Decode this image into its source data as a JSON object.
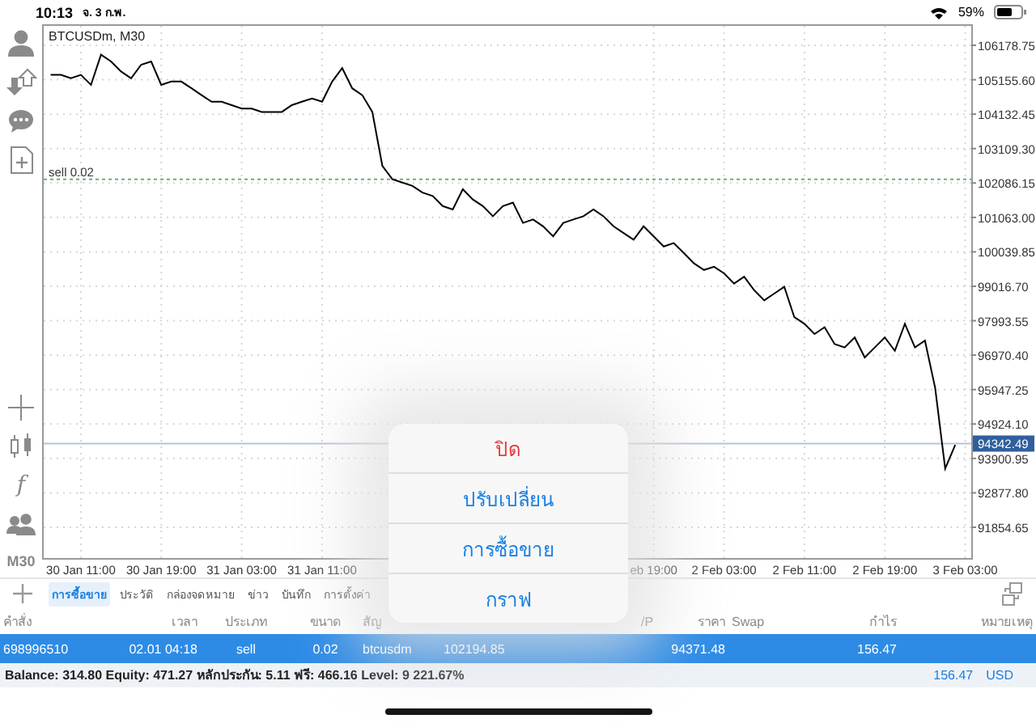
{
  "status_bar": {
    "time": "10:13",
    "date": "จ. 3 ก.พ.",
    "battery": "59%"
  },
  "toolbar": {
    "top": [
      {
        "kind": "person"
      },
      {
        "kind": "arrows"
      },
      {
        "kind": "chat"
      },
      {
        "kind": "document"
      }
    ],
    "bottom": [
      {
        "kind": "crosshair"
      },
      {
        "kind": "candles"
      },
      {
        "kind": "text",
        "label": "f"
      },
      {
        "kind": "people"
      },
      {
        "kind": "text",
        "label": "M30"
      }
    ]
  },
  "chart": {
    "title": "BTCUSDm, M30",
    "chart_data": {
      "type": "line",
      "grid": true,
      "categories": [
        null,
        null,
        null,
        "30 Jan 11:00",
        null,
        null,
        null,
        null,
        null,
        null,
        null,
        "30 Jan 19:00",
        null,
        null,
        null,
        null,
        null,
        null,
        null,
        "31 Jan 03:00",
        null,
        null,
        null,
        null,
        null,
        null,
        null,
        "31 Jan 11:00",
        null,
        null,
        null,
        null,
        null,
        null,
        null,
        null,
        null,
        null,
        null,
        null,
        null,
        null,
        null,
        null,
        null,
        null,
        null,
        null,
        null,
        null,
        null,
        null,
        null,
        null,
        null,
        null,
        null,
        null,
        null,
        null,
        "eb 19:00",
        null,
        null,
        null,
        null,
        null,
        null,
        "2 Feb 03:00",
        null,
        null,
        null,
        null,
        null,
        null,
        null,
        "2 Feb 11:00",
        null,
        null,
        null,
        null,
        null,
        null,
        null,
        "2 Feb 19:00",
        null,
        null,
        null,
        null,
        null,
        null,
        null,
        "3 Feb 03:00"
      ],
      "series": [
        {
          "color": "#000000",
          "values": [
            105300,
            105300,
            105200,
            105300,
            105000,
            105900,
            105700,
            105400,
            105200,
            105600,
            105700,
            105000,
            105100,
            105100,
            104900,
            104700,
            104500,
            104500,
            104400,
            104300,
            104300,
            104200,
            104200,
            104200,
            104400,
            104500,
            104600,
            104500,
            105100,
            105500,
            104900,
            104700,
            104200,
            102600,
            102200,
            102100,
            102000,
            101800,
            101700,
            101400,
            101300,
            101900,
            101600,
            101400,
            101100,
            101400,
            101500,
            100900,
            101000,
            100800,
            100500,
            100900,
            101000,
            101100,
            101300,
            101100,
            100800,
            100600,
            100400,
            100800,
            100500,
            100200,
            100300,
            100000,
            99700,
            99500,
            99600,
            99400,
            99100,
            99300,
            98900,
            98600,
            98800,
            99000,
            98100,
            97900,
            97600,
            97800,
            97300,
            97200,
            97500,
            96900,
            97200,
            97500,
            97100,
            97900,
            97200,
            97400,
            96000,
            93600,
            94300,
            null
          ]
        }
      ],
      "ylim": [
        90941,
        106756
      ],
      "yticks": [
        {
          "value": 106178.75,
          "label": "106178.75"
        },
        {
          "value": 105155.6,
          "label": "105155.60"
        },
        {
          "value": 104132.45,
          "label": "104132.45"
        },
        {
          "value": 103109.3,
          "label": "103109.30"
        },
        {
          "value": 102086.15,
          "label": "102086.15"
        },
        {
          "value": 101063,
          "label": "101063.00"
        },
        {
          "value": 100039.85,
          "label": "100039.85"
        },
        {
          "value": 99016.7,
          "label": "99016.70"
        },
        {
          "value": 97993.55,
          "label": "97993.55"
        },
        {
          "value": 96970.4,
          "label": "96970.40"
        },
        {
          "value": 95947.25,
          "label": "95947.25"
        },
        {
          "value": 94924.1,
          "label": "94924.10"
        },
        {
          "value": 93900.95,
          "label": "93900.95"
        },
        {
          "value": 92877.8,
          "label": "92877.80"
        },
        {
          "value": 91854.65,
          "label": "91854.65"
        }
      ],
      "ref_lines": [
        {
          "axis": "y",
          "value": 102194.85,
          "label": "sell 0.02",
          "color": "#6fae6f"
        },
        {
          "axis": "y",
          "value": 94342.49,
          "color": "#b8c4d4"
        }
      ]
    },
    "price_tag": "94342.49"
  },
  "tabs": [
    {
      "label": "การซื้อขาย",
      "selected": true
    },
    {
      "label": "ประวัติ",
      "selected": false
    },
    {
      "label": "กล่องจดหมาย",
      "selected": false
    },
    {
      "label": "ข่าว",
      "selected": false
    },
    {
      "label": "บันทึก",
      "selected": false
    },
    {
      "label": "การตั้งค่า",
      "selected": false
    }
  ],
  "table": {
    "columns": [
      "คำสั่ง",
      "เวลา",
      "ประเภท",
      "ขนาด",
      "สัญ",
      null,
      null,
      "/P",
      "ราคา",
      "Swap",
      "กำไร",
      "หมายเหตุ"
    ],
    "rows": [
      {
        "selected": true,
        "cells": [
          "698996510",
          "02.01 04:18",
          "sell",
          "0.02",
          "btcusdm",
          "102194.85",
          "",
          "",
          "94371.48",
          "",
          "156.47"
        ]
      }
    ]
  },
  "summary": {
    "text": "Balance: 314.80 Equity: 471.27 หลักประกัน: 5.11 ฟรี: 466.16 Level: 9 221.67%",
    "profit": "156.47",
    "currency": "USD"
  },
  "menu": [
    {
      "label": "ปิด",
      "kind": "destructive"
    },
    {
      "label": "ปรับเปลี่ยน",
      "kind": "normal"
    },
    {
      "label": "การซื้อขาย",
      "kind": "normal"
    },
    {
      "label": "กราฟ",
      "kind": "normal"
    }
  ]
}
